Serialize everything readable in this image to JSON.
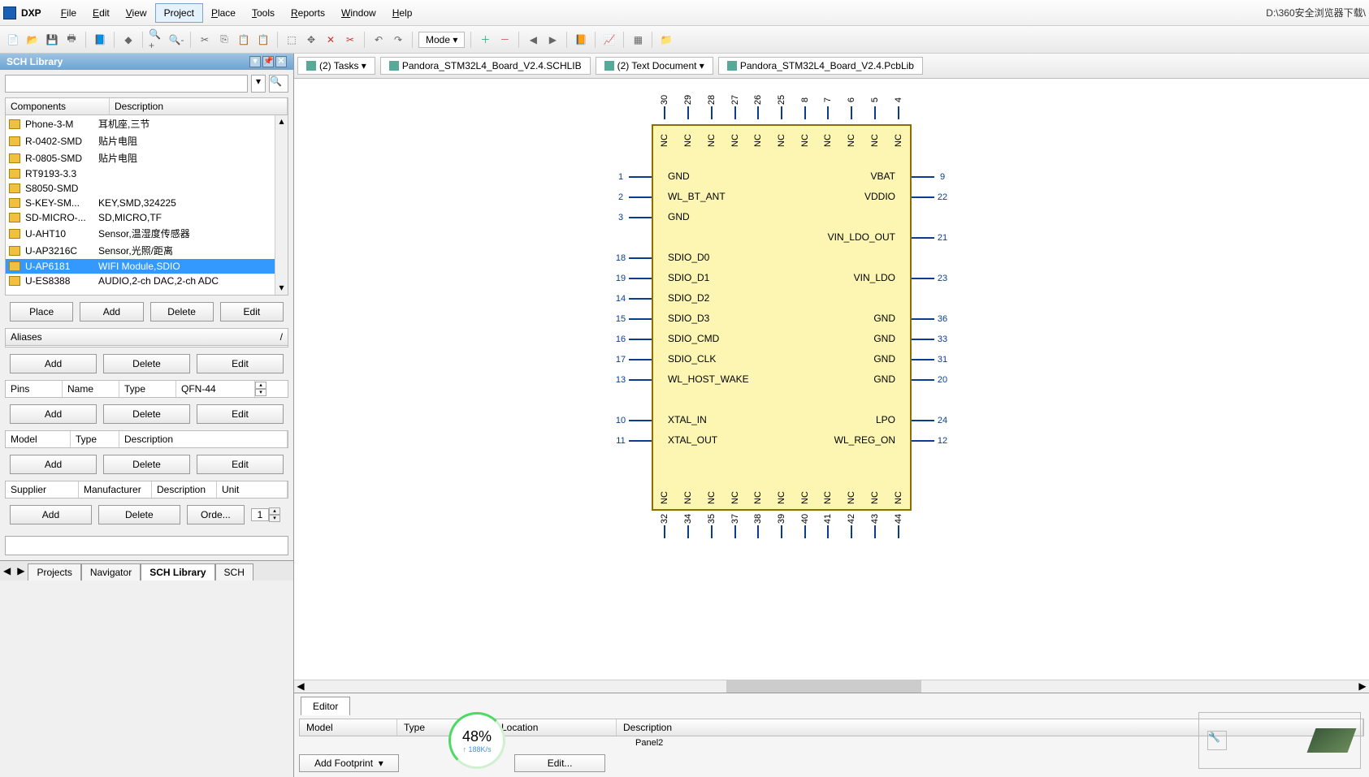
{
  "app": {
    "name": "DXP",
    "path": "D:\\360安全浏览器下载\\"
  },
  "menus": [
    "File",
    "Edit",
    "View",
    "Project",
    "Place",
    "Tools",
    "Reports",
    "Window",
    "Help"
  ],
  "menu_active_index": 3,
  "panel": {
    "title": "SCH Library"
  },
  "grid_headers": {
    "c1": "Components",
    "c2": "Description"
  },
  "components": [
    {
      "name": "Phone-3-M",
      "desc": "耳机座,三节"
    },
    {
      "name": "R-0402-SMD",
      "desc": "贴片电阻"
    },
    {
      "name": "R-0805-SMD",
      "desc": "贴片电阻"
    },
    {
      "name": "RT9193-3.3",
      "desc": ""
    },
    {
      "name": "S8050-SMD",
      "desc": ""
    },
    {
      "name": "S-KEY-SM...",
      "desc": "KEY,SMD,324225"
    },
    {
      "name": "SD-MICRO-...",
      "desc": "SD,MICRO,TF"
    },
    {
      "name": "U-AHT10",
      "desc": "Sensor,温湿度传感器"
    },
    {
      "name": "U-AP3216C",
      "desc": "Sensor,光照/距离"
    },
    {
      "name": "U-AP6181",
      "desc": "WIFI Module,SDIO",
      "selected": true
    },
    {
      "name": "U-ES8388",
      "desc": "AUDIO,2-ch DAC,2-ch ADC"
    }
  ],
  "buttons": {
    "place": "Place",
    "add": "Add",
    "delete": "Delete",
    "edit": "Edit",
    "order": "Orde..."
  },
  "aliases_head": "Aliases",
  "pins": {
    "h1": "Pins",
    "h2": "Name",
    "h3": "Type",
    "val": "QFN-44"
  },
  "model_headers": {
    "h1": "Model",
    "h2": "Type",
    "h3": "Description"
  },
  "supplier_headers": {
    "h1": "Supplier",
    "h2": "Manufacturer",
    "h3": "Description",
    "h4": "Unit"
  },
  "spinner_val": "1",
  "bottom_tabs": [
    "Projects",
    "Navigator",
    "SCH Library",
    "SCH"
  ],
  "bottom_active": 2,
  "doc_tabs": [
    {
      "label": "(2) Tasks",
      "drop": true
    },
    {
      "label": "Pandora_STM32L4_Board_V2.4.SCHLIB"
    },
    {
      "label": "(2) Text Document",
      "drop": true
    },
    {
      "label": "Pandora_STM32L4_Board_V2.4.PcbLib"
    }
  ],
  "mode_label": "Mode",
  "chip": {
    "top_pins": [
      "30",
      "29",
      "28",
      "27",
      "26",
      "25",
      "8",
      "7",
      "6",
      "5",
      "4"
    ],
    "bot_pins": [
      "32",
      "34",
      "35",
      "37",
      "38",
      "39",
      "40",
      "41",
      "42",
      "43",
      "44"
    ],
    "left_pins": [
      "1",
      "2",
      "3",
      "",
      "18",
      "19",
      "14",
      "15",
      "16",
      "17",
      "13",
      "",
      "10",
      "11"
    ],
    "right_pins": [
      "9",
      "22",
      "",
      "21",
      "",
      "23",
      "",
      "36",
      "33",
      "31",
      "20",
      "",
      "24",
      "12"
    ],
    "left_labels": [
      "GND",
      "WL_BT_ANT",
      "GND",
      "",
      "SDIO_D0",
      "SDIO_D1",
      "SDIO_D2",
      "SDIO_D3",
      "SDIO_CMD",
      "SDIO_CLK",
      "WL_HOST_WAKE",
      "",
      "XTAL_IN",
      "XTAL_OUT"
    ],
    "right_labels": [
      "VBAT",
      "VDDIO",
      "",
      "VIN_LDO_OUT",
      "",
      "VIN_LDO",
      "",
      "GND",
      "GND",
      "GND",
      "GND",
      "",
      "LPO",
      "WL_REG_ON"
    ],
    "nc": "NC"
  },
  "editor": {
    "tab": "Editor",
    "headers": {
      "model": "Model",
      "type": "Type",
      "location": "Location",
      "description": "Description"
    },
    "panel_label": "Panel2",
    "add_footprint": "Add Footprint",
    "edit": "Edit..."
  },
  "gauge": {
    "pct": "48%",
    "spd": "↑ 188K/s"
  }
}
